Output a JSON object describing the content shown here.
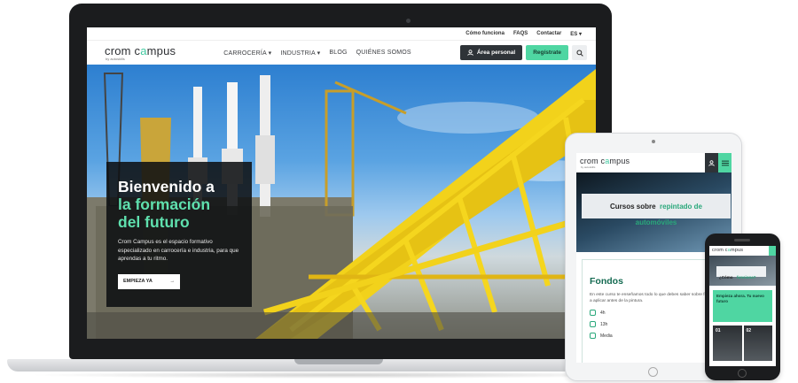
{
  "laptop": {
    "topbar": {
      "como": "Cómo funciona",
      "faqs": "FAQS",
      "contactar": "Contactar",
      "lang": "ES",
      "lang_arrow": "▾"
    },
    "logo": {
      "part1": "crom c",
      "accent": "a",
      "part2": "mpus",
      "sub": "by autoskills"
    },
    "menu": [
      "CARROCERÍA ▾",
      "INDUSTRIA ▾",
      "BLOG",
      "QUIÉNES SOMOS"
    ],
    "area_personal": "Área personal",
    "registrate": "Regístrate",
    "hero": {
      "title_line1": "Bienvenido a",
      "title_line2": "la formación",
      "title_line3": "del futuro",
      "description": "Crom Campus es el espacio formativo especializado en carrocería e industria, para que aprendas a tu ritmo.",
      "cta": "EMPIEZA YA",
      "cta_arrow": "→"
    }
  },
  "tablet": {
    "hero_text": "Cursos sobre",
    "hero_highlight": "repintado de automóviles",
    "section_title": "Fondos",
    "section_text": "En este curso te enseñamos todo lo que debes saber sobre fondos a aplicar antes de la pintura.",
    "meta": [
      "4h",
      "13h",
      "Media"
    ]
  },
  "phone": {
    "hero_text": "¿Cómo",
    "hero_highlight": "funciona?",
    "cta_text": "Empieza ahora. Tu nuevo futuro",
    "tiles": [
      "01",
      "02"
    ]
  },
  "colors": {
    "accent": "#4fd6a2",
    "dark": "#2e3338",
    "highlight": "#5fe0ae"
  }
}
